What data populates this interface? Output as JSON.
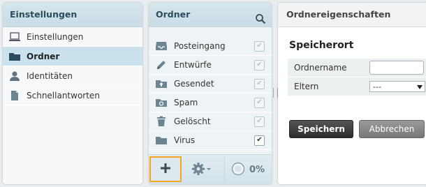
{
  "settings_panel": {
    "title": "Einstellungen",
    "items": [
      {
        "label": "Einstellungen",
        "icon": "laptop-icon",
        "selected": false
      },
      {
        "label": "Ordner",
        "icon": "folder-icon",
        "selected": true
      },
      {
        "label": "Identitäten",
        "icon": "user-icon",
        "selected": false
      },
      {
        "label": "Schnellantworten",
        "icon": "document-icon",
        "selected": false
      }
    ]
  },
  "folders_panel": {
    "title": "Ordner",
    "search_icon": "search-icon",
    "folders": [
      {
        "name": "Posteingang",
        "icon": "inbox-icon",
        "subscribed": true,
        "editable": false
      },
      {
        "name": "Entwürfe",
        "icon": "pencil-icon",
        "subscribed": true,
        "editable": false
      },
      {
        "name": "Gesendet",
        "icon": "sent-icon",
        "subscribed": true,
        "editable": false
      },
      {
        "name": "Spam",
        "icon": "recycle-icon",
        "subscribed": true,
        "editable": false
      },
      {
        "name": "Gelöscht",
        "icon": "trash-icon",
        "subscribed": true,
        "editable": false
      },
      {
        "name": "Virus",
        "icon": "folder-icon",
        "subscribed": true,
        "editable": true
      }
    ],
    "footer": {
      "add_icon": "plus-icon",
      "options_icon": "gear-icon",
      "quota": "0%"
    }
  },
  "properties_panel": {
    "title": "Ordnereigenschaften",
    "section": "Speicherort",
    "fields": {
      "name_label": "Ordnername",
      "name_value": "",
      "parent_label": "Eltern",
      "parent_value": "---"
    },
    "save_label": "Speichern",
    "cancel_label": "Abbrechen"
  },
  "colors": {
    "accent_highlight": "#f5a623",
    "header_bg": "#cfe1e8",
    "primary_button": "#333333"
  }
}
